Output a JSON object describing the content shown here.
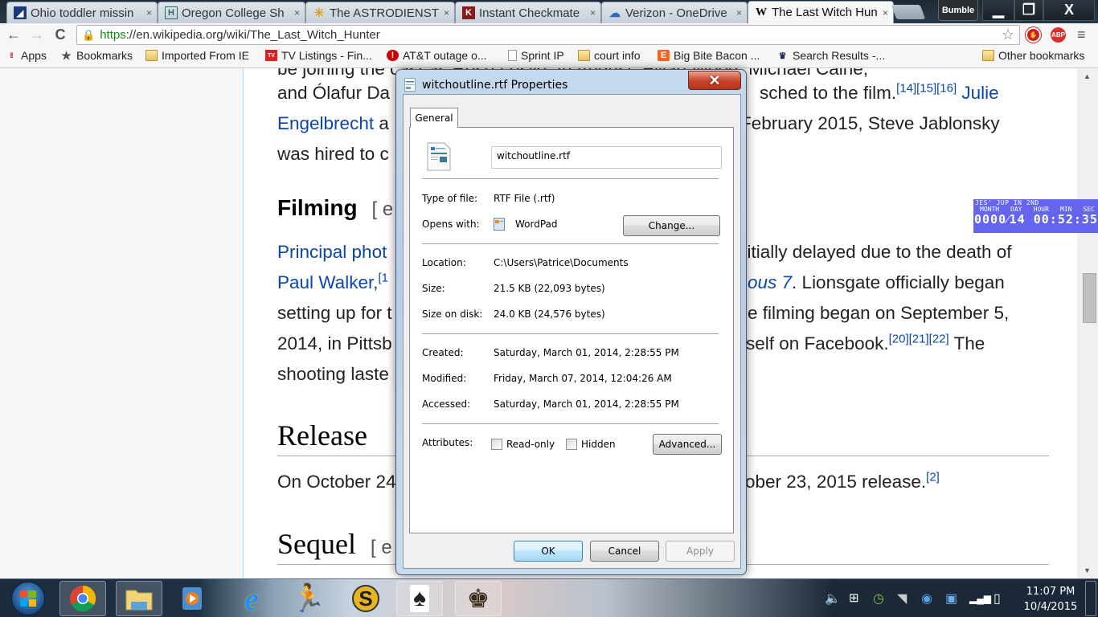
{
  "browser": {
    "tabs": [
      {
        "title": "Ohio toddler missin",
        "icon": "news-flag-icon"
      },
      {
        "title": "Oregon College Sh",
        "icon": "h-letter-icon"
      },
      {
        "title": "The ASTRODIENST",
        "icon": "sun-star-icon"
      },
      {
        "title": "Instant Checkmate",
        "icon": "checkmate-icon"
      },
      {
        "title": "Verizon - OneDrive",
        "icon": "cloud-icon"
      },
      {
        "title": "The Last Witch Hun",
        "icon": "wikipedia-icon",
        "active": true
      }
    ],
    "close_glyph": "×",
    "profile_label": "Bumble",
    "window_controls": {
      "minimize": "▁",
      "restore": "❐",
      "close": "X"
    },
    "nav": {
      "back": "←",
      "forward": "→",
      "reload": "C"
    },
    "url": {
      "scheme": "https",
      "rest": "://en.wikipedia.org/wiki/The_Last_Witch_Hunter"
    },
    "extensions": [
      {
        "name": "stop-sign-extension",
        "label": "✋",
        "color": "#cc1f1f"
      },
      {
        "name": "adblock-plus",
        "label": "ABP",
        "color": "#d9302c"
      }
    ],
    "bookmarks": [
      {
        "label": "Apps",
        "icon": "apps-grid-icon"
      },
      {
        "label": "Bookmarks",
        "icon": "star-icon"
      },
      {
        "label": "Imported From IE",
        "icon": "folder-icon"
      },
      {
        "label": "TV Listings - Fin...",
        "icon": "tv-guide-icon"
      },
      {
        "label": "AT&T outage o...",
        "icon": "alert-icon"
      },
      {
        "label": "Sprint IP",
        "icon": "page-icon"
      },
      {
        "label": "court info",
        "icon": "folder-icon"
      },
      {
        "label": "Big Bite Bacon ...",
        "icon": "etsy-icon"
      },
      {
        "label": "Search Results -...",
        "icon": "royal-caribbean-icon"
      }
    ],
    "other_bookmarks": "Other bookmarks"
  },
  "article": {
    "line0": "be joining the cast as Rose Leslie. In August, Elijah Wood, Michael Caine,",
    "line1_a": "and Ólafur Da",
    "line1_b": "rnur Darri Ólafsson were also announced as attached to the film.",
    "line1_refs": "[14][15][16]",
    "line1_link": "Julie",
    "line2_link": "Engelbrecht",
    "line2_a": " a",
    "line2_b": "February 2015, Steve Jablonsky",
    "line3": "was hired to c",
    "filming_heading": "Filming",
    "edit_bracket": "[ e",
    "fp1_link": "Principal phot",
    "fp1_b": "nitially delayed due to the death of",
    "fp2_link": "Paul Walker,",
    "fp2_ref": "[1",
    "fp2_italic": "ous 7",
    "fp2_b": ". Lionsgate officially began",
    "fp3_a": "setting up for t",
    "fp3_b": "e filming began on September 5,",
    "fp4_a": "2014, in Pittsb",
    "fp4_b": "self on Facebook.",
    "fp4_refs": "[20][21][22]",
    "fp4_c": " The",
    "fp5_a": "shooting laste",
    "release_heading": "Release",
    "release_a": "On October 24",
    "release_b": "ober 23, 2015 release.",
    "release_ref": "[2]",
    "sequel_heading": "Sequel",
    "sequel_edit": "[ e"
  },
  "clock_gadget": {
    "title": "JES' JUP IN 2ND",
    "labels": [
      "MONTH",
      "DAY",
      "HOUR",
      "MIN",
      "SEC"
    ],
    "value": "0000⁄14 00:52:35"
  },
  "dialog": {
    "title": "witchoutline.rtf Properties",
    "close": "✕",
    "tab": "General",
    "filename": "witchoutline.rtf",
    "rows1": [
      {
        "label": "Type of file:",
        "value": "RTF File (.rtf)"
      },
      {
        "label": "Opens with:",
        "value": "WordPad"
      }
    ],
    "change_button": "Change...",
    "rows2": [
      {
        "label": "Location:",
        "value": "C:\\Users\\Patrice\\Documents"
      },
      {
        "label": "Size:",
        "value": "21.5 KB (22,093 bytes)"
      },
      {
        "label": "Size on disk:",
        "value": "24.0 KB (24,576 bytes)"
      }
    ],
    "rows3": [
      {
        "label": "Created:",
        "value": "Saturday, March 01, 2014, 2:28:55 PM"
      },
      {
        "label": "Modified:",
        "value": "Friday, March 07, 2014, 12:04:26 AM"
      },
      {
        "label": "Accessed:",
        "value": "Saturday, March 01, 2014, 2:28:55 PM"
      }
    ],
    "attributes_label": "Attributes:",
    "readonly_label": "Read-only",
    "readonly_checked": false,
    "hidden_label": "Hidden",
    "hidden_checked": false,
    "advanced_button": "Advanced...",
    "ok_button": "OK",
    "cancel_button": "Cancel",
    "apply_button": "Apply"
  },
  "taskbar": {
    "apps": [
      "chrome",
      "file-explorer",
      "media-player",
      "internet-explorer",
      "aim",
      "slingbox",
      "solitaire",
      "chess-titans"
    ],
    "tray": [
      "volume",
      "windows",
      "clock-app",
      "speaker",
      "download-update",
      "display",
      "signal",
      "battery"
    ],
    "time": "11:07 PM",
    "date": "10/4/2015"
  }
}
